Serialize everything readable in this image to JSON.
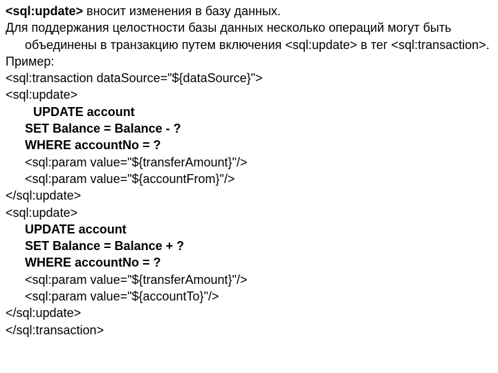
{
  "intro": {
    "tag_open": "<sql:update>",
    "intro_text": " вносит изменения в базу данных.",
    "line2a": "Для поддержания целостности базы данных несколько операций могут быть объединены в транзакцию путем включения ",
    "line2b": "<sql:update>",
    "line2c": " в тег ",
    "line2d": "<sql:transaction>",
    "line2e": ".",
    "example_label": "Пример:"
  },
  "code": {
    "t_open": "<sql:transaction dataSource=\"${dataSource}\">",
    "u_open": "<sql:update>",
    "upd1": "UPDATE account",
    "set_minus": "SET Balance = Balance - ?",
    "set_plus": "SET Balance = Balance + ?",
    "where": "WHERE accountNo = ?",
    "p_amount": "<sql:param value=\"${transferAmount}\"/>",
    "p_from": "<sql:param value=\"${accountFrom}\"/>",
    "p_to": "<sql:param value=\"${accountTo}\"/>",
    "u_close": "</sql:update>",
    "t_close": "</sql:transaction>"
  }
}
